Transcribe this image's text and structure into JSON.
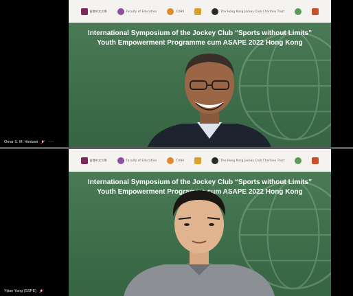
{
  "logos": [
    "香港中文大學",
    "Faculty of Education",
    "CUHK",
    "The Hong Kong Jockey Club Charities Trust",
    "",
    ""
  ],
  "event_title_line1": "International Symposium of the Jockey Club “Sports without Limits”",
  "event_title_line2": "Youth Empowerment Programme cum ASAPE 2022 Hong Kong",
  "participants": [
    {
      "name": "Omar S. M. Hindawi",
      "muted": true,
      "more": "···"
    },
    {
      "name": "Yijian Yang (SSPE)",
      "muted": true
    }
  ],
  "colors": {
    "slide_green": "#3f6f4b",
    "logo_bar": "#f4f3ef",
    "divider": "#5a5a5a"
  },
  "icons": {
    "muted": "mic-muted-icon"
  }
}
